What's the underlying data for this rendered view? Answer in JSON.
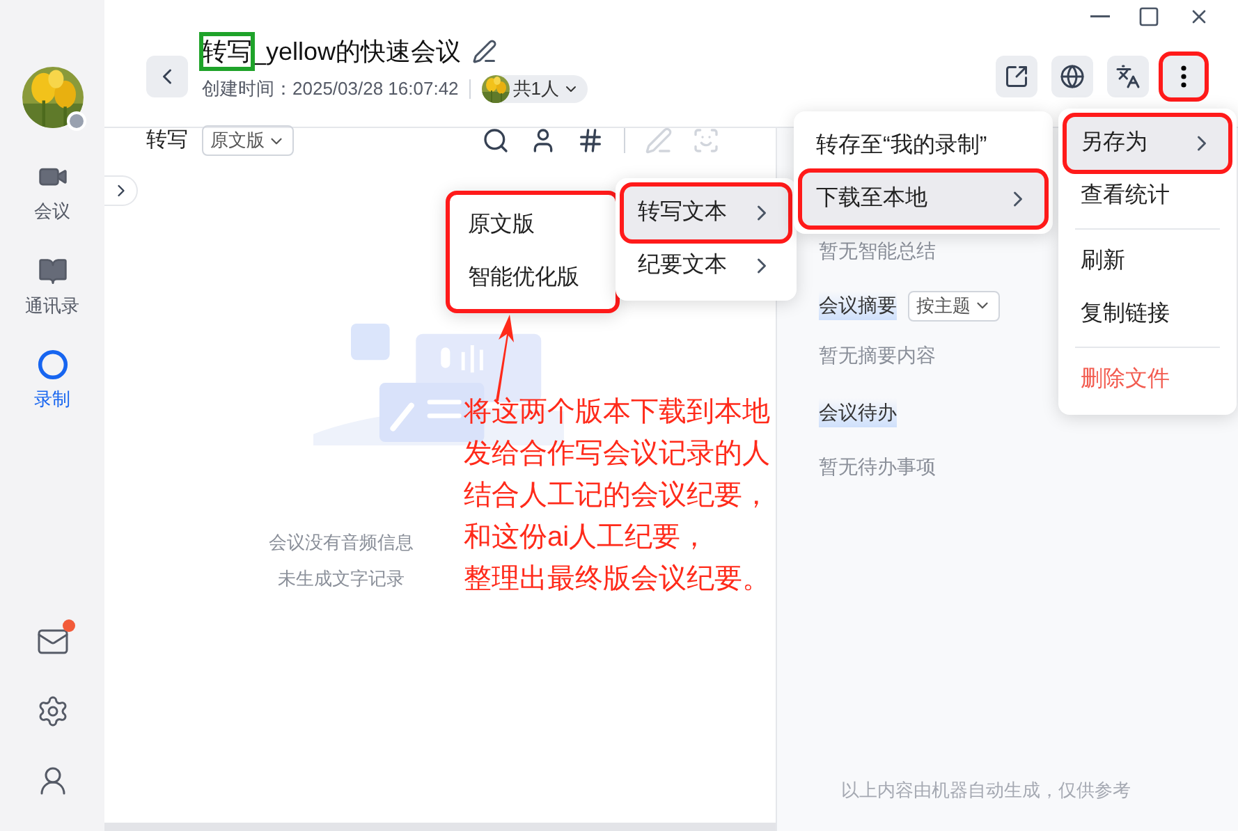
{
  "window_controls": [
    {
      "kind": "minimize"
    },
    {
      "kind": "maximize"
    },
    {
      "kind": "close"
    }
  ],
  "sidebar": {
    "avatar": {
      "kind": "picture",
      "badge": true
    },
    "items": [
      {
        "kind": "video",
        "label": "会议",
        "selected": false
      },
      {
        "kind": "book",
        "label": "通讯录",
        "selected": false
      },
      {
        "kind": "record",
        "label": "录制",
        "selected": true
      }
    ],
    "bottom": [
      {
        "kind": "mail",
        "badge": true
      },
      {
        "kind": "settings",
        "badge": false
      },
      {
        "kind": "switch-user",
        "badge": false
      }
    ]
  },
  "header": {
    "title": "转写_yellow的快速会议",
    "title_boxed": true,
    "created": "创建时间：2025/03/28 16:07:42",
    "participants": "共1人",
    "actions": [
      {
        "kind": "share",
        "annotated": false
      },
      {
        "kind": "globe",
        "annotated": false
      },
      {
        "kind": "translate",
        "annotated": false
      },
      {
        "kind": "more",
        "annotated": true
      }
    ]
  },
  "transcript": {
    "label": "转写",
    "version": "原文版",
    "tools": [
      {
        "kind": "search",
        "disabled": false
      },
      {
        "kind": "user",
        "disabled": false
      },
      {
        "kind": "hash",
        "disabled": false
      },
      {
        "kind": "divider"
      },
      {
        "kind": "pen",
        "disabled": true
      },
      {
        "kind": "scan",
        "disabled": true
      }
    ],
    "empty": [
      "会议没有音频信息",
      "未生成文字记录"
    ]
  },
  "summary": {
    "no_summary": "暂无智能总结",
    "section": "会议摘要",
    "sort": "按主题",
    "no_abstract": "暂无摘要内容",
    "todo": "会议待办",
    "no_todo": "暂无待办事项",
    "footer": "以上内容由机器自动生成，仅供参考"
  },
  "menus": [
    {
      "annotated": true,
      "items": [
        {
          "kind": "item",
          "label": "原文版",
          "selected": false,
          "submenu": false,
          "danger": false,
          "annotated": false
        },
        {
          "kind": "item",
          "label": "智能优化版",
          "selected": false,
          "submenu": false,
          "danger": false,
          "annotated": false
        }
      ]
    },
    {
      "annotated": false,
      "items": [
        {
          "kind": "item",
          "label": "转写文本",
          "selected": true,
          "submenu": true,
          "danger": false,
          "annotated": true
        },
        {
          "kind": "item",
          "label": "纪要文本",
          "selected": false,
          "submenu": true,
          "danger": false,
          "annotated": false
        }
      ]
    },
    {
      "annotated": false,
      "items": [
        {
          "kind": "item",
          "label": "转存至“我的录制”",
          "selected": false,
          "submenu": false,
          "danger": false,
          "annotated": false
        },
        {
          "kind": "item",
          "label": "下载至本地",
          "selected": true,
          "submenu": true,
          "danger": false,
          "annotated": true
        }
      ]
    },
    {
      "annotated": false,
      "items": [
        {
          "kind": "item",
          "label": "另存为",
          "selected": true,
          "submenu": true,
          "danger": false,
          "annotated": true
        },
        {
          "kind": "item",
          "label": "查看统计",
          "selected": false,
          "submenu": false,
          "danger": false,
          "annotated": false
        },
        {
          "kind": "divider"
        },
        {
          "kind": "item",
          "label": "刷新",
          "selected": false,
          "submenu": false,
          "danger": false,
          "annotated": false
        },
        {
          "kind": "item",
          "label": "复制链接",
          "selected": false,
          "submenu": false,
          "danger": false,
          "annotated": false
        },
        {
          "kind": "divider"
        },
        {
          "kind": "item",
          "label": "删除文件",
          "selected": false,
          "submenu": false,
          "danger": true,
          "annotated": false
        }
      ]
    }
  ],
  "annotation": {
    "color": "#ff2a1a",
    "lines": [
      "将这两个版本下载到本地",
      "发给合作写会议记录的人",
      "结合人工记的会议纪要，",
      "和这份ai人工纪要，",
      "整理出最终版会议纪要。"
    ]
  }
}
